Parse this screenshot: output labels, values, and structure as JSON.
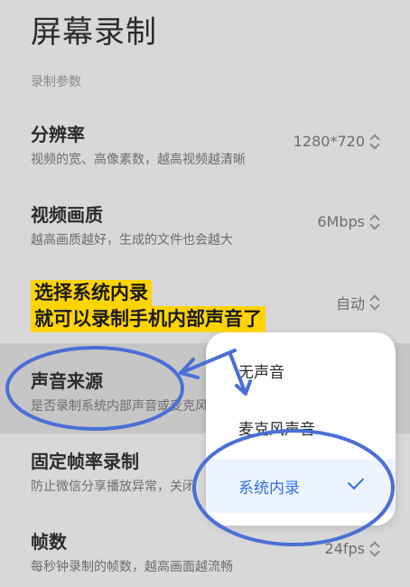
{
  "header": {
    "title": "屏幕录制"
  },
  "section": {
    "label": "录制参数"
  },
  "settings": [
    {
      "title": "分辨率",
      "desc": "视频的宽、高像素数，越高视频越清晰",
      "value": "1280*720"
    },
    {
      "title": "视频画质",
      "desc": "越高画质越好，生成的文件也会越大",
      "value": "6Mbps"
    },
    {
      "title": "",
      "desc": "",
      "value": "自动"
    },
    {
      "title": "声音来源",
      "desc": "是否录制系统内部声音或麦克风",
      "value": ""
    },
    {
      "title": "固定帧率录制",
      "desc": "防止微信分享播放异常，关闭",
      "value": ""
    },
    {
      "title": "帧数",
      "desc": "每秒钟录制的帧数，越高画面越流畅",
      "value": "24fps"
    }
  ],
  "popup": {
    "options": [
      "无声音",
      "麦克风声音",
      "系统内录"
    ],
    "selected_index": 2
  },
  "annotation": {
    "line1": "选择系统内录",
    "line2": "就可以录制手机内部声音了"
  },
  "colors": {
    "accent": "#2f6fe4",
    "annotation_bg": "#ffd400",
    "markup": "#4a6fd6"
  }
}
